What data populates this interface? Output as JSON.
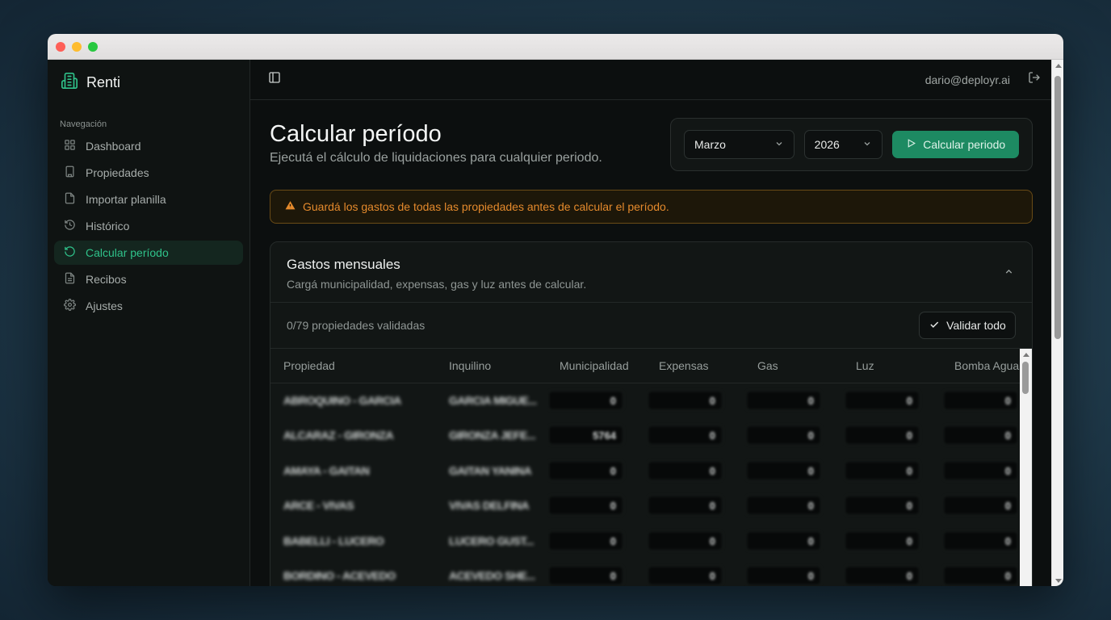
{
  "app": {
    "name": "Renti"
  },
  "sidebar": {
    "heading": "Navegación",
    "items": [
      {
        "label": "Dashboard",
        "icon": "grid-icon",
        "active": false
      },
      {
        "label": "Propiedades",
        "icon": "building-icon",
        "active": false
      },
      {
        "label": "Importar planilla",
        "icon": "file-import-icon",
        "active": false
      },
      {
        "label": "Histórico",
        "icon": "history-icon",
        "active": false
      },
      {
        "label": "Calcular período",
        "icon": "rotate-icon",
        "active": true
      },
      {
        "label": "Recibos",
        "icon": "receipt-icon",
        "active": false
      },
      {
        "label": "Ajustes",
        "icon": "gear-icon",
        "active": false
      }
    ]
  },
  "topbar": {
    "user_email": "dario@deployr.ai"
  },
  "page": {
    "title": "Calcular período",
    "subtitle": "Ejecutá el cálculo de liquidaciones para cualquier periodo."
  },
  "controls": {
    "month": "Marzo",
    "year": "2026",
    "calculate_label": "Calcular periodo"
  },
  "alert": {
    "text": "Guardá los gastos de todas las propiedades antes de calcular el período."
  },
  "card": {
    "title": "Gastos mensuales",
    "subtitle": "Cargá municipalidad, expensas, gas y luz antes de calcular.",
    "validated_text": "0/79 propiedades validadas",
    "validate_all_label": "Validar todo"
  },
  "table": {
    "columns": [
      "Propiedad",
      "Inquilino",
      "Municipalidad",
      "Expensas",
      "Gas",
      "Luz",
      "Bomba Agua"
    ],
    "rows": [
      {
        "propiedad": "ABROQUINO - GARCIA",
        "inquilino": "GARCIA MIGUE...",
        "values": [
          "0",
          "0",
          "0",
          "0",
          "0"
        ]
      },
      {
        "propiedad": "ALCARAZ - GIRONZA",
        "inquilino": "GIRONZA JEFE...",
        "values": [
          "5764",
          "0",
          "0",
          "0",
          "0"
        ]
      },
      {
        "propiedad": "AMAYA - GAITAN",
        "inquilino": "GAITAN YANINA",
        "values": [
          "0",
          "0",
          "0",
          "0",
          "0"
        ]
      },
      {
        "propiedad": "ARCE - VIVAS",
        "inquilino": "VIVAS DELFINA",
        "values": [
          "0",
          "0",
          "0",
          "0",
          "0"
        ]
      },
      {
        "propiedad": "BABELLI - LUCERO",
        "inquilino": "LUCERO GUST...",
        "values": [
          "0",
          "0",
          "0",
          "0",
          "0"
        ]
      },
      {
        "propiedad": "BORDINO - ACEVEDO",
        "inquilino": "ACEVEDO SHE...",
        "values": [
          "0",
          "0",
          "0",
          "0",
          "0"
        ]
      }
    ]
  },
  "colors": {
    "accent": "#2fc28a",
    "primary_button": "#1d8a62",
    "warning": "#e58a2c"
  }
}
